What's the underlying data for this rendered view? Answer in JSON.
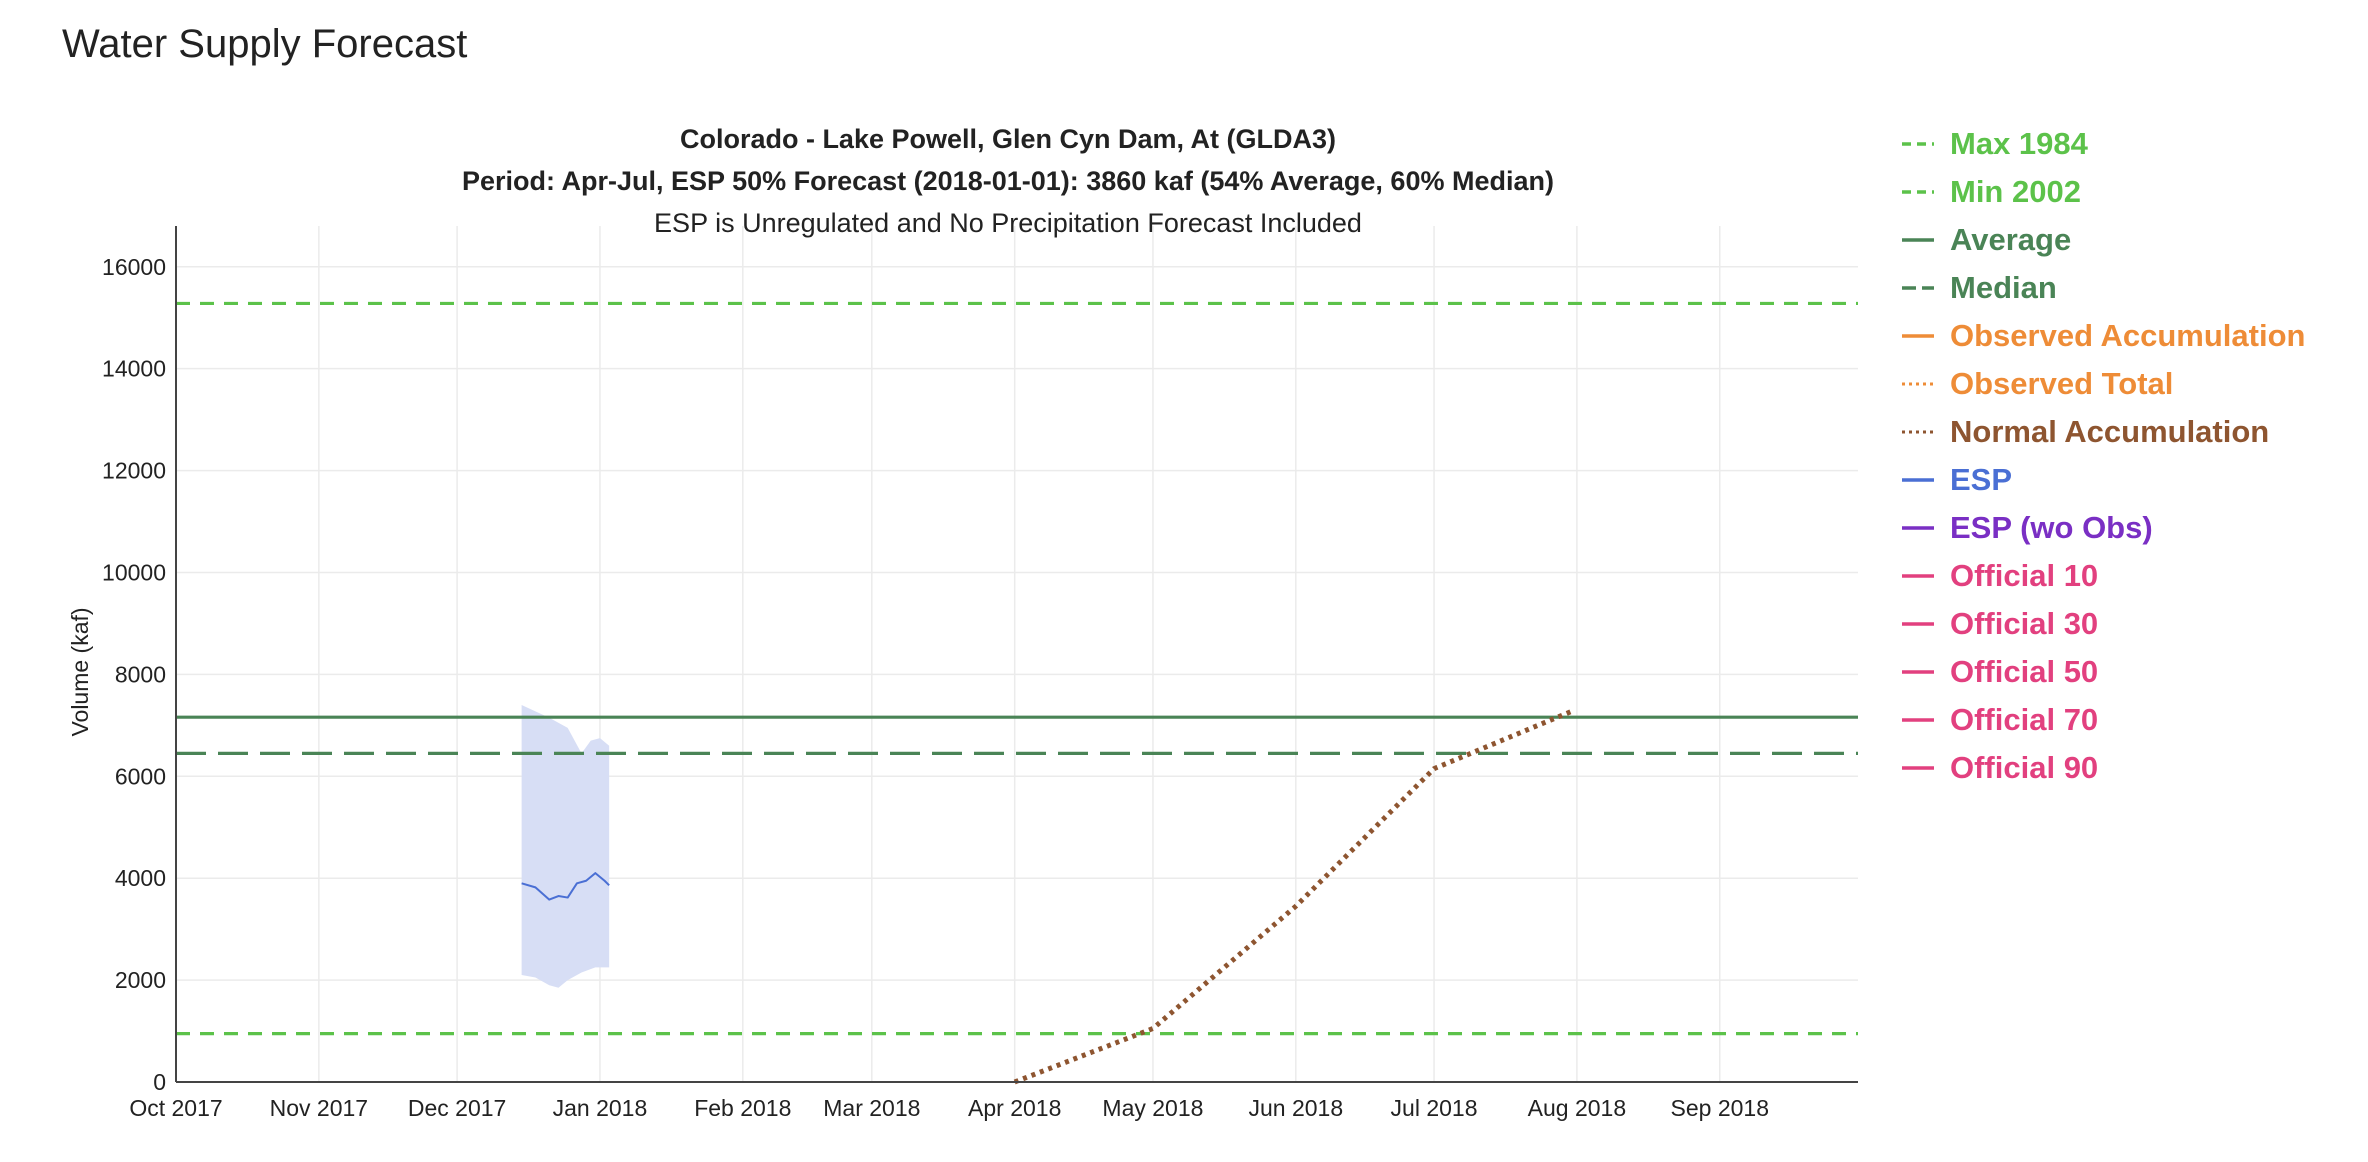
{
  "page": {
    "title": "Water Supply Forecast"
  },
  "chart_data": {
    "type": "line",
    "title": "Colorado - Lake Powell, Glen Cyn Dam, At (GLDA3)",
    "subtitle": "Period: Apr-Jul, ESP 50% Forecast (2018-01-01): 3860 kaf (54% Average, 60% Median)",
    "note": "ESP is Unregulated and No Precipitation Forecast Included",
    "xlabel": "",
    "ylabel": "Volume (kaf)",
    "ylim": [
      0,
      16800
    ],
    "xlim": [
      "2017-10-01",
      "2018-10-01"
    ],
    "grid": true,
    "legend_position": "right",
    "y_ticks": [
      0,
      2000,
      4000,
      6000,
      8000,
      10000,
      12000,
      14000,
      16000
    ],
    "x_ticks": [
      {
        "date": "2017-10-01",
        "label": "Oct 2017"
      },
      {
        "date": "2017-11-01",
        "label": "Nov 2017"
      },
      {
        "date": "2017-12-01",
        "label": "Dec 2017"
      },
      {
        "date": "2018-01-01",
        "label": "Jan 2018"
      },
      {
        "date": "2018-02-01",
        "label": "Feb 2018"
      },
      {
        "date": "2018-03-01",
        "label": "Mar 2018"
      },
      {
        "date": "2018-04-01",
        "label": "Apr 2018"
      },
      {
        "date": "2018-05-01",
        "label": "May 2018"
      },
      {
        "date": "2018-06-01",
        "label": "Jun 2018"
      },
      {
        "date": "2018-07-01",
        "label": "Jul 2018"
      },
      {
        "date": "2018-08-01",
        "label": "Aug 2018"
      },
      {
        "date": "2018-09-01",
        "label": "Sep 2018"
      }
    ],
    "series": [
      {
        "name": "Max 1984",
        "color": "#5cc24a",
        "style": "dash",
        "kind": "hline",
        "value": 15280
      },
      {
        "name": "Min 2002",
        "color": "#5cc24a",
        "style": "dash",
        "kind": "hline",
        "value": 950
      },
      {
        "name": "Average",
        "color": "#4a8456",
        "style": "solid",
        "kind": "hline",
        "value": 7160
      },
      {
        "name": "Median",
        "color": "#4a8456",
        "style": "longdash",
        "kind": "hline",
        "value": 6450
      },
      {
        "name": "Observed Accumulation",
        "color": "#ee8c37",
        "style": "solid",
        "kind": "line",
        "points": []
      },
      {
        "name": "Observed Total",
        "color": "#ee8c37",
        "style": "dot",
        "kind": "line",
        "points": []
      },
      {
        "name": "Normal Accumulation",
        "color": "#8e5530",
        "style": "dot",
        "kind": "line",
        "points": [
          {
            "x": "2018-04-01",
            "y": 0
          },
          {
            "x": "2018-05-01",
            "y": 1050
          },
          {
            "x": "2018-06-01",
            "y": 3450
          },
          {
            "x": "2018-07-01",
            "y": 6150
          },
          {
            "x": "2018-07-31",
            "y": 7280
          }
        ]
      },
      {
        "name": "ESP",
        "color": "#4a6fd4",
        "style": "solid",
        "kind": "line",
        "points": [
          {
            "x": "2017-12-15",
            "y": 3900
          },
          {
            "x": "2017-12-18",
            "y": 3820
          },
          {
            "x": "2017-12-21",
            "y": 3580
          },
          {
            "x": "2017-12-23",
            "y": 3650
          },
          {
            "x": "2017-12-25",
            "y": 3620
          },
          {
            "x": "2017-12-27",
            "y": 3900
          },
          {
            "x": "2017-12-29",
            "y": 3950
          },
          {
            "x": "2017-12-31",
            "y": 4100
          },
          {
            "x": "2018-01-02",
            "y": 3950
          },
          {
            "x": "2018-01-03",
            "y": 3860
          }
        ]
      },
      {
        "name": "ESP (wo Obs)",
        "color": "#7a2fc4",
        "style": "solid",
        "kind": "line",
        "points": []
      },
      {
        "name": "Official 10",
        "color": "#e2407f",
        "style": "solid",
        "kind": "line",
        "points": []
      },
      {
        "name": "Official 30",
        "color": "#e2407f",
        "style": "solid",
        "kind": "line",
        "points": []
      },
      {
        "name": "Official 50",
        "color": "#e2407f",
        "style": "solid",
        "kind": "line",
        "points": []
      },
      {
        "name": "Official 70",
        "color": "#e2407f",
        "style": "solid",
        "kind": "line",
        "points": []
      },
      {
        "name": "Official 90",
        "color": "#e2407f",
        "style": "solid",
        "kind": "line",
        "points": []
      }
    ],
    "esp_band": {
      "color": "#d7def5",
      "upper": [
        {
          "x": "2017-12-15",
          "y": 7400
        },
        {
          "x": "2017-12-21",
          "y": 7150
        },
        {
          "x": "2017-12-25",
          "y": 6950
        },
        {
          "x": "2017-12-28",
          "y": 6450
        },
        {
          "x": "2017-12-30",
          "y": 6700
        },
        {
          "x": "2018-01-01",
          "y": 6750
        },
        {
          "x": "2018-01-03",
          "y": 6600
        }
      ],
      "lower": [
        {
          "x": "2017-12-15",
          "y": 2100
        },
        {
          "x": "2017-12-18",
          "y": 2050
        },
        {
          "x": "2017-12-21",
          "y": 1900
        },
        {
          "x": "2017-12-23",
          "y": 1850
        },
        {
          "x": "2017-12-25",
          "y": 2000
        },
        {
          "x": "2017-12-28",
          "y": 2150
        },
        {
          "x": "2017-12-31",
          "y": 2250
        },
        {
          "x": "2018-01-03",
          "y": 2250
        }
      ]
    }
  }
}
